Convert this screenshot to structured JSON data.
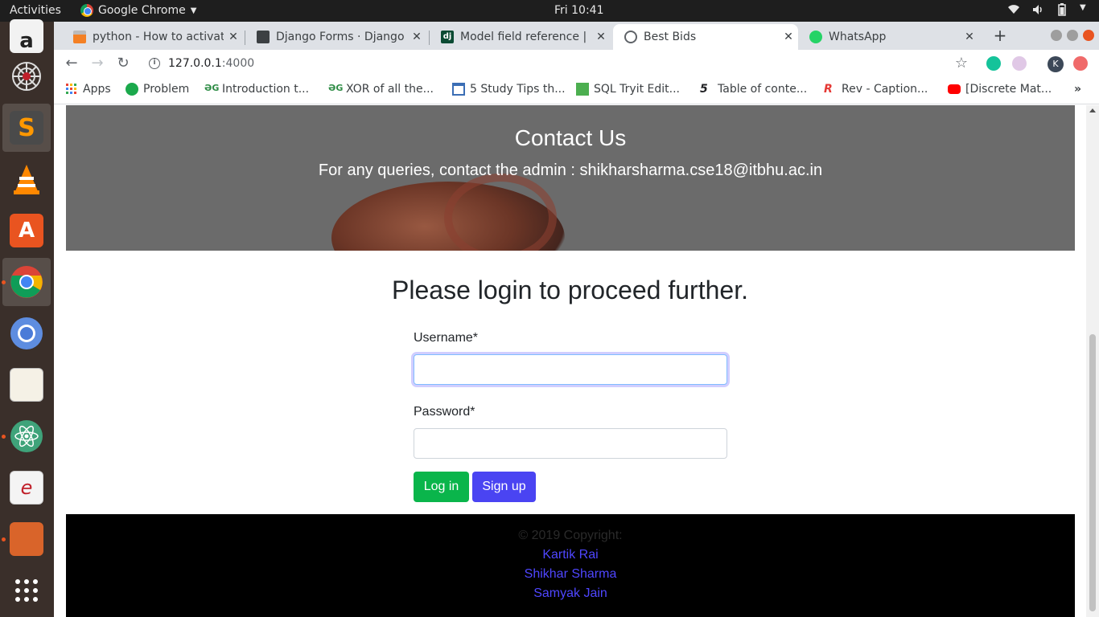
{
  "system": {
    "activities": "Activities",
    "app_menu": "Google Chrome",
    "clock": "Fri 10:41"
  },
  "dock": {
    "items": [
      "amazon-icon",
      "spider-icon",
      "sublime-text-icon",
      "vlc-icon",
      "software-center-icon",
      "chrome-icon",
      "chromium-icon",
      "text-editor-icon",
      "atom-icon",
      "document-viewer-icon",
      "archive-manager-icon",
      "show-apps-icon"
    ]
  },
  "tabs": [
    {
      "title": "python - How to activate",
      "favicon": "stackoverflow-icon"
    },
    {
      "title": "Django Forms · Django C",
      "favicon": "django-book-icon"
    },
    {
      "title": "Model field reference | D",
      "favicon": "django-icon"
    },
    {
      "title": "Best Bids",
      "favicon": "globe-icon",
      "active": true
    },
    {
      "title": "WhatsApp",
      "favicon": "whatsapp-icon"
    }
  ],
  "toolbar": {
    "url_host": "127.0.0.1",
    "url_port": ":4000",
    "profile_initial": "K"
  },
  "bookmarks": [
    {
      "label": "Apps",
      "icon": "apps-grid-icon"
    },
    {
      "label": "Problem",
      "icon": "hackerrank-icon"
    },
    {
      "label": "Introduction t...",
      "icon": "geeksforgeeks-icon"
    },
    {
      "label": "XOR of all the...",
      "icon": "geeksforgeeks-icon"
    },
    {
      "label": "5 Study Tips th...",
      "icon": "institution-icon"
    },
    {
      "label": "SQL Tryit Edit...",
      "icon": "w3schools-icon"
    },
    {
      "label": "Table of conte...",
      "icon": "fivefilters-icon"
    },
    {
      "label": "Rev - Caption...",
      "icon": "rev-icon"
    },
    {
      "label": "[Discrete Mat...",
      "icon": "youtube-icon"
    }
  ],
  "hero": {
    "title": "Contact Us",
    "text": "For any queries, contact the admin : shikharsharma.cse18@itbhu.ac.in"
  },
  "login": {
    "heading": "Please login to proceed further.",
    "username_label": "Username*",
    "username_value": "",
    "password_label": "Password*",
    "password_value": "",
    "login_button": "Log in",
    "signup_button": "Sign up"
  },
  "footer": {
    "copyright": "© 2019 Copyright:",
    "authors": [
      "Kartik Rai",
      "Shikhar Sharma",
      "Samyak Jain"
    ]
  },
  "colors": {
    "login_button": "#0ab54b",
    "signup_button": "#4a44f2",
    "author_link": "#4f46ff",
    "hero_bg": "#6b6b6b",
    "footer_bg": "#000000"
  }
}
